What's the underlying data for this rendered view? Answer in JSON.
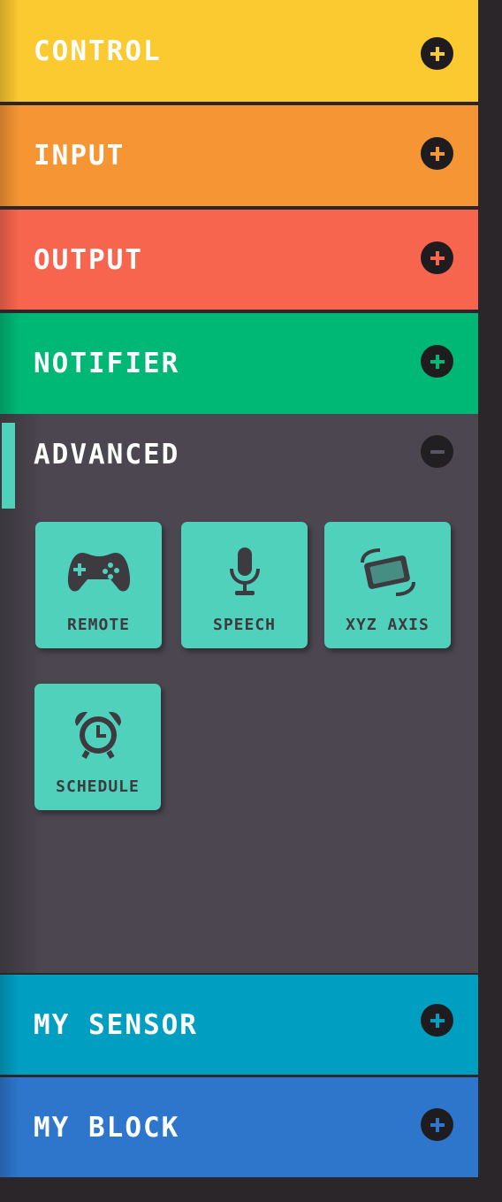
{
  "categories": [
    {
      "label": "CONTROL",
      "color": "#fbc930",
      "icon": "plus-icon"
    },
    {
      "label": "INPUT",
      "color": "#f59534",
      "icon": "plus-icon"
    },
    {
      "label": "OUTPUT",
      "color": "#f8654e",
      "icon": "plus-icon"
    },
    {
      "label": "NOTIFIER",
      "color": "#00b875",
      "icon": "plus-icon"
    },
    {
      "label": "ADVANCED",
      "color": "#4b464f",
      "icon": "minus-icon",
      "expanded": true
    },
    {
      "label": "MY SENSOR",
      "color": "#009fc2",
      "icon": "plus-icon"
    },
    {
      "label": "MY BLOCK",
      "color": "#2d76cc",
      "icon": "plus-icon"
    }
  ],
  "advanced_blocks": [
    {
      "label": "REMOTE",
      "icon": "gamepad-icon"
    },
    {
      "label": "SPEECH",
      "icon": "microphone-icon"
    },
    {
      "label": "XYZ AXIS",
      "icon": "rotate-device-icon"
    },
    {
      "label": "SCHEDULE",
      "icon": "alarm-clock-icon"
    }
  ],
  "colors": {
    "accent": "#4fd1bc",
    "tile_text": "#3d3a40",
    "background": "#2a2629"
  }
}
